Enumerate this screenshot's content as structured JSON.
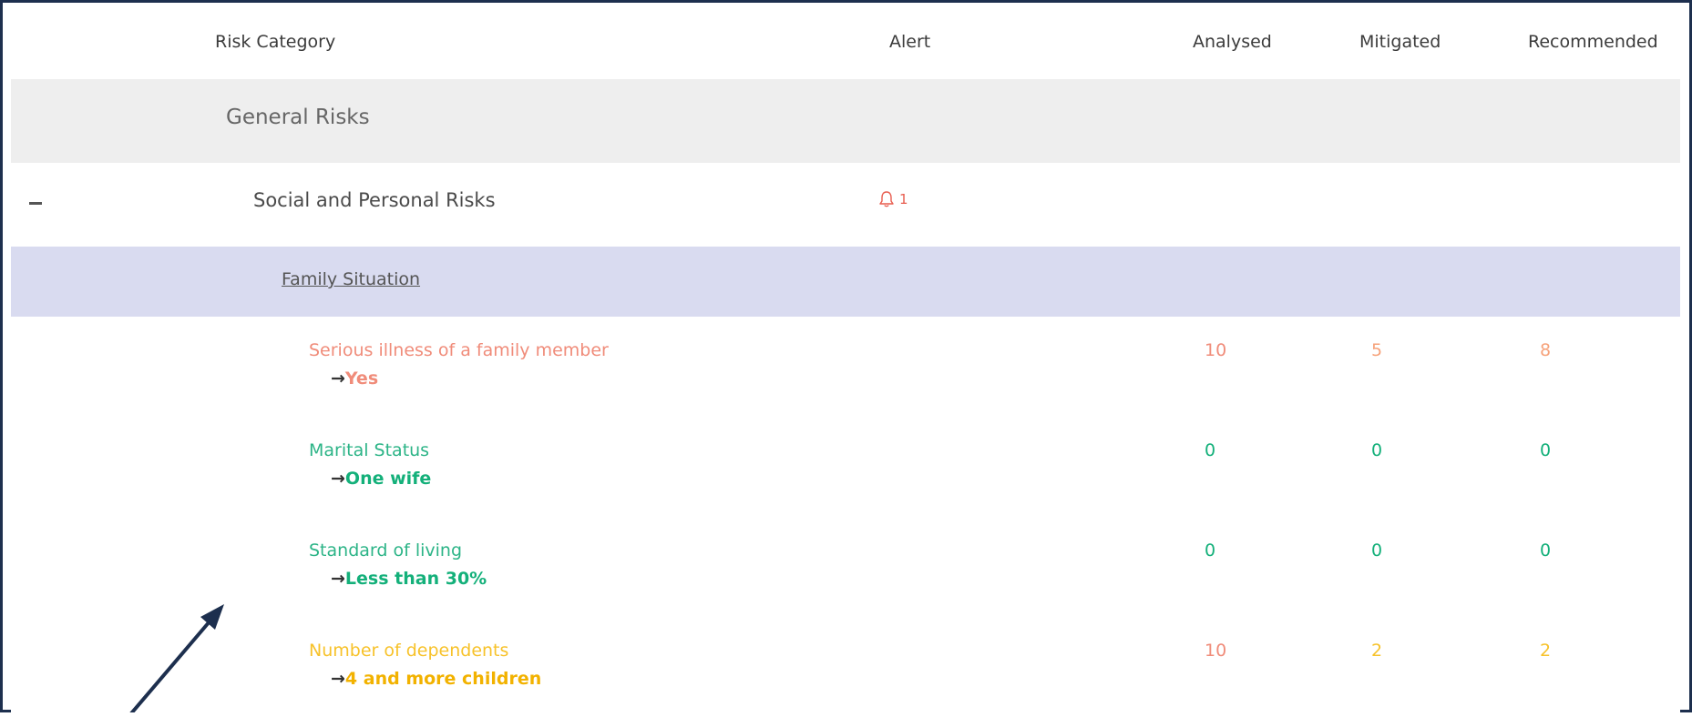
{
  "header": {
    "risk_category": "Risk Category",
    "alert": "Alert",
    "analysed": "Analysed",
    "mitigated": "Mitigated",
    "recommended": "Recommended"
  },
  "general_risks": {
    "label": "General Risks"
  },
  "social_risks": {
    "label": "Social and Personal Risks",
    "alert_icon": "bell-icon",
    "alert_count": "1",
    "collapse_icon": "minus-icon"
  },
  "family_situation": {
    "label": "Family Situation"
  },
  "items": [
    {
      "name": "Serious illness of a family member",
      "arrow": "→",
      "value": "Yes",
      "analysed": "10",
      "mitigated": "5",
      "recommended": "8"
    },
    {
      "name": "Marital Status",
      "arrow": "→",
      "value": "One wife",
      "analysed": "0",
      "mitigated": "0",
      "recommended": "0"
    },
    {
      "name": "Standard of living",
      "arrow": "→",
      "value": "Less than 30%",
      "analysed": "0",
      "mitigated": "0",
      "recommended": "0"
    },
    {
      "name": "Number of dependents",
      "arrow": "→",
      "value": "4 and more children",
      "analysed": "10",
      "mitigated": "2",
      "recommended": "2"
    }
  ],
  "colors": {
    "frame": "#1d2f4e",
    "alert_red": "#e85d4f",
    "risk_high": "#f08c7a",
    "risk_low": "#14b07a",
    "risk_medium": "#f2b200",
    "subgroup_bg": "#d9dbf0"
  },
  "annotation": {
    "icon": "arrow-pointer-icon"
  }
}
